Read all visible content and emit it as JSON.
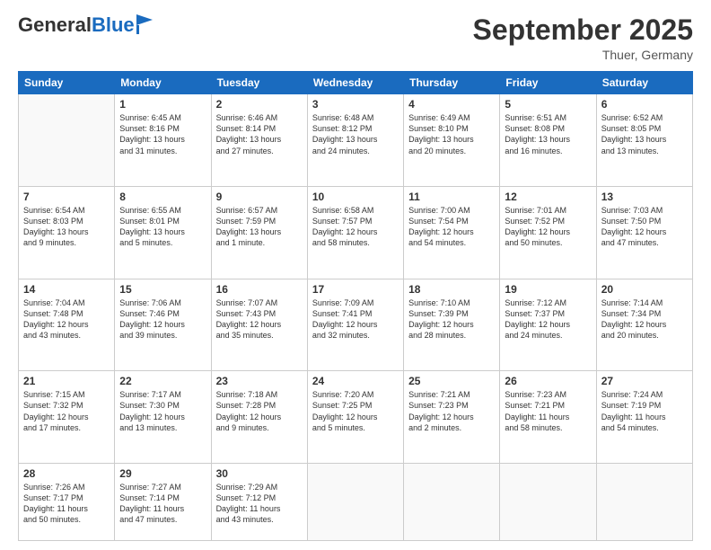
{
  "header": {
    "logo_general": "General",
    "logo_blue": "Blue",
    "month_title": "September 2025",
    "location": "Thuer, Germany"
  },
  "weekdays": [
    "Sunday",
    "Monday",
    "Tuesday",
    "Wednesday",
    "Thursday",
    "Friday",
    "Saturday"
  ],
  "weeks": [
    [
      {
        "day": "",
        "info": ""
      },
      {
        "day": "1",
        "info": "Sunrise: 6:45 AM\nSunset: 8:16 PM\nDaylight: 13 hours\nand 31 minutes."
      },
      {
        "day": "2",
        "info": "Sunrise: 6:46 AM\nSunset: 8:14 PM\nDaylight: 13 hours\nand 27 minutes."
      },
      {
        "day": "3",
        "info": "Sunrise: 6:48 AM\nSunset: 8:12 PM\nDaylight: 13 hours\nand 24 minutes."
      },
      {
        "day": "4",
        "info": "Sunrise: 6:49 AM\nSunset: 8:10 PM\nDaylight: 13 hours\nand 20 minutes."
      },
      {
        "day": "5",
        "info": "Sunrise: 6:51 AM\nSunset: 8:08 PM\nDaylight: 13 hours\nand 16 minutes."
      },
      {
        "day": "6",
        "info": "Sunrise: 6:52 AM\nSunset: 8:05 PM\nDaylight: 13 hours\nand 13 minutes."
      }
    ],
    [
      {
        "day": "7",
        "info": "Sunrise: 6:54 AM\nSunset: 8:03 PM\nDaylight: 13 hours\nand 9 minutes."
      },
      {
        "day": "8",
        "info": "Sunrise: 6:55 AM\nSunset: 8:01 PM\nDaylight: 13 hours\nand 5 minutes."
      },
      {
        "day": "9",
        "info": "Sunrise: 6:57 AM\nSunset: 7:59 PM\nDaylight: 13 hours\nand 1 minute."
      },
      {
        "day": "10",
        "info": "Sunrise: 6:58 AM\nSunset: 7:57 PM\nDaylight: 12 hours\nand 58 minutes."
      },
      {
        "day": "11",
        "info": "Sunrise: 7:00 AM\nSunset: 7:54 PM\nDaylight: 12 hours\nand 54 minutes."
      },
      {
        "day": "12",
        "info": "Sunrise: 7:01 AM\nSunset: 7:52 PM\nDaylight: 12 hours\nand 50 minutes."
      },
      {
        "day": "13",
        "info": "Sunrise: 7:03 AM\nSunset: 7:50 PM\nDaylight: 12 hours\nand 47 minutes."
      }
    ],
    [
      {
        "day": "14",
        "info": "Sunrise: 7:04 AM\nSunset: 7:48 PM\nDaylight: 12 hours\nand 43 minutes."
      },
      {
        "day": "15",
        "info": "Sunrise: 7:06 AM\nSunset: 7:46 PM\nDaylight: 12 hours\nand 39 minutes."
      },
      {
        "day": "16",
        "info": "Sunrise: 7:07 AM\nSunset: 7:43 PM\nDaylight: 12 hours\nand 35 minutes."
      },
      {
        "day": "17",
        "info": "Sunrise: 7:09 AM\nSunset: 7:41 PM\nDaylight: 12 hours\nand 32 minutes."
      },
      {
        "day": "18",
        "info": "Sunrise: 7:10 AM\nSunset: 7:39 PM\nDaylight: 12 hours\nand 28 minutes."
      },
      {
        "day": "19",
        "info": "Sunrise: 7:12 AM\nSunset: 7:37 PM\nDaylight: 12 hours\nand 24 minutes."
      },
      {
        "day": "20",
        "info": "Sunrise: 7:14 AM\nSunset: 7:34 PM\nDaylight: 12 hours\nand 20 minutes."
      }
    ],
    [
      {
        "day": "21",
        "info": "Sunrise: 7:15 AM\nSunset: 7:32 PM\nDaylight: 12 hours\nand 17 minutes."
      },
      {
        "day": "22",
        "info": "Sunrise: 7:17 AM\nSunset: 7:30 PM\nDaylight: 12 hours\nand 13 minutes."
      },
      {
        "day": "23",
        "info": "Sunrise: 7:18 AM\nSunset: 7:28 PM\nDaylight: 12 hours\nand 9 minutes."
      },
      {
        "day": "24",
        "info": "Sunrise: 7:20 AM\nSunset: 7:25 PM\nDaylight: 12 hours\nand 5 minutes."
      },
      {
        "day": "25",
        "info": "Sunrise: 7:21 AM\nSunset: 7:23 PM\nDaylight: 12 hours\nand 2 minutes."
      },
      {
        "day": "26",
        "info": "Sunrise: 7:23 AM\nSunset: 7:21 PM\nDaylight: 11 hours\nand 58 minutes."
      },
      {
        "day": "27",
        "info": "Sunrise: 7:24 AM\nSunset: 7:19 PM\nDaylight: 11 hours\nand 54 minutes."
      }
    ],
    [
      {
        "day": "28",
        "info": "Sunrise: 7:26 AM\nSunset: 7:17 PM\nDaylight: 11 hours\nand 50 minutes."
      },
      {
        "day": "29",
        "info": "Sunrise: 7:27 AM\nSunset: 7:14 PM\nDaylight: 11 hours\nand 47 minutes."
      },
      {
        "day": "30",
        "info": "Sunrise: 7:29 AM\nSunset: 7:12 PM\nDaylight: 11 hours\nand 43 minutes."
      },
      {
        "day": "",
        "info": ""
      },
      {
        "day": "",
        "info": ""
      },
      {
        "day": "",
        "info": ""
      },
      {
        "day": "",
        "info": ""
      }
    ]
  ]
}
